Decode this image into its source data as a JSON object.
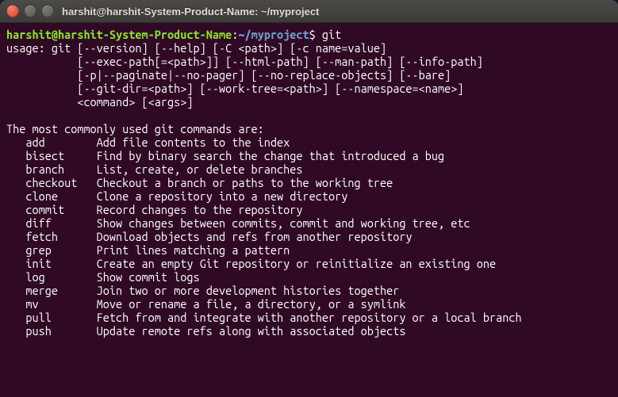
{
  "titlebar": {
    "title": "harshit@harshit-System-Product-Name: ~/myproject"
  },
  "prompt": {
    "user_host": "harshit@harshit-System-Product-Name",
    "sep": ":",
    "path": "~/myproject",
    "dollar": "$",
    "command": "git"
  },
  "usage": {
    "l1": "usage: git [--version] [--help] [-C <path>] [-c name=value]",
    "l2": "           [--exec-path[=<path>]] [--html-path] [--man-path] [--info-path]",
    "l3": "           [-p|--paginate|--no-pager] [--no-replace-objects] [--bare]",
    "l4": "           [--git-dir=<path>] [--work-tree=<path>] [--namespace=<name>]",
    "l5": "           <command> [<args>]"
  },
  "heading": "The most commonly used git commands are:",
  "commands": [
    {
      "name": "add",
      "desc": "Add file contents to the index"
    },
    {
      "name": "bisect",
      "desc": "Find by binary search the change that introduced a bug"
    },
    {
      "name": "branch",
      "desc": "List, create, or delete branches"
    },
    {
      "name": "checkout",
      "desc": "Checkout a branch or paths to the working tree"
    },
    {
      "name": "clone",
      "desc": "Clone a repository into a new directory"
    },
    {
      "name": "commit",
      "desc": "Record changes to the repository"
    },
    {
      "name": "diff",
      "desc": "Show changes between commits, commit and working tree, etc"
    },
    {
      "name": "fetch",
      "desc": "Download objects and refs from another repository"
    },
    {
      "name": "grep",
      "desc": "Print lines matching a pattern"
    },
    {
      "name": "init",
      "desc": "Create an empty Git repository or reinitialize an existing one"
    },
    {
      "name": "log",
      "desc": "Show commit logs"
    },
    {
      "name": "merge",
      "desc": "Join two or more development histories together"
    },
    {
      "name": "mv",
      "desc": "Move or rename a file, a directory, or a symlink"
    },
    {
      "name": "pull",
      "desc": "Fetch from and integrate with another repository or a local branch"
    },
    {
      "name": "push",
      "desc": "Update remote refs along with associated objects"
    }
  ]
}
